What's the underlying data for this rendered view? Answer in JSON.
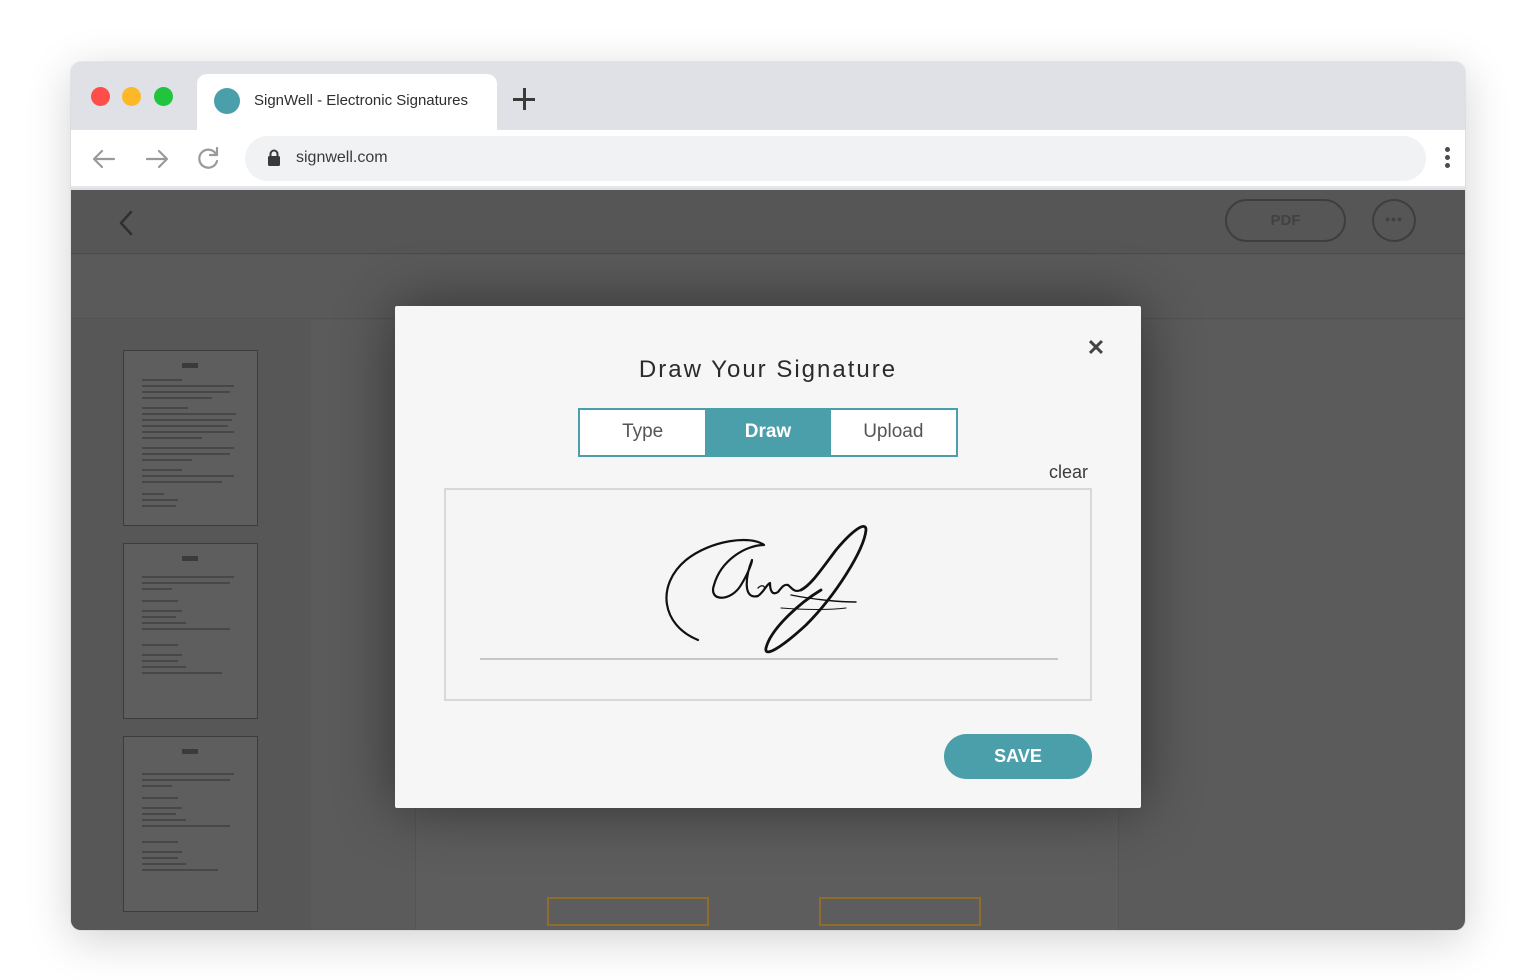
{
  "browser": {
    "tab_title": "SignWell - Electronic Signatures",
    "url": "signwell.com",
    "icons": [
      "close-window-icon",
      "minimize-icon",
      "maximize-icon",
      "new-tab-icon",
      "back-arrow-icon",
      "forward-arrow-icon",
      "reload-icon",
      "lock-icon",
      "kebab-menu-icon"
    ]
  },
  "app": {
    "pdf_label": "PDF",
    "more_label": "•••"
  },
  "modal": {
    "title": "Draw Your Signature",
    "close_label": "✕",
    "tabs": [
      {
        "label": "Type",
        "active": false
      },
      {
        "label": "Draw",
        "active": true
      },
      {
        "label": "Upload",
        "active": false
      }
    ],
    "clear_label": "clear",
    "save_label": "SAVE"
  },
  "colors": {
    "accent": "#4a9fab",
    "overlay": "#5a5959",
    "modal_bg": "#f6f6f6"
  }
}
